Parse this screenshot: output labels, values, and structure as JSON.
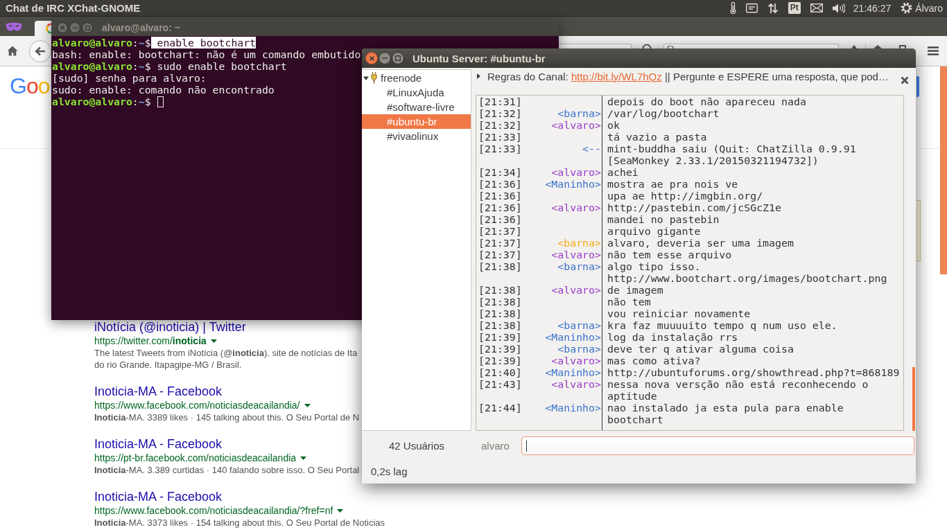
{
  "top_panel": {
    "app_title": "Chat de IRC XChat-GNOME",
    "keyboard": "Pt",
    "clock": "21:46:27",
    "user": "Álvaro"
  },
  "browser": {
    "logo": "Goo",
    "results": [
      {
        "title": "iNotícia (@inoticia) | Twitter",
        "url": "https://twitter.com/**inoticia**",
        "snippet": [
          "The latest Tweets from iNotícia (@**inoticia**). site de notícias de Ita",
          "do rio Grande. Itapagipe-MG / Brasil."
        ]
      },
      {
        "title": "Inoticia-MA - Facebook",
        "url": "https://www.facebook.com/noticiasdeacailandia/",
        "snippet": [
          "**Inoticia**-MA. 3389 likes · 145 talking about this. O Seu Portal de N"
        ]
      },
      {
        "title": "Inoticia-MA - Facebook",
        "url": "https://pt-br.facebook.com/noticiasdeacailandia",
        "snippet": [
          "**Inoticia**-MA. 3.389 curtidas · 140 falando sobre isso. O Seu Portal"
        ]
      },
      {
        "title": "Inoticia-MA - Facebook",
        "url": "https://www.facebook.com/noticiasdeacailandia/?fref=nf",
        "snippet": [
          "**Inoticia**-MA. 3373 likes · 154 talking about this. O Seu Portal de Noticias"
        ]
      }
    ]
  },
  "terminal": {
    "title": "alvaro@alvaro: ~",
    "cursor": true,
    "lines": [
      {
        "segments": [
          {
            "kind": "user",
            "text": "alvaro@alvaro"
          },
          {
            "kind": "plain",
            "text": ":"
          },
          {
            "kind": "path",
            "text": "~"
          },
          {
            "kind": "plain",
            "text": "$"
          },
          {
            "kind": "selection",
            "text": " enable bootchart"
          }
        ]
      },
      {
        "segments": [
          {
            "kind": "plain",
            "text": "bash: enable: bootchart: não é um comando embutido"
          }
        ]
      },
      {
        "segments": [
          {
            "kind": "user",
            "text": "alvaro@alvaro"
          },
          {
            "kind": "plain",
            "text": ":"
          },
          {
            "kind": "path",
            "text": "~"
          },
          {
            "kind": "plain",
            "text": "$ sudo enable bootchart"
          }
        ]
      },
      {
        "segments": [
          {
            "kind": "plain",
            "text": "[sudo] senha para alvaro:"
          }
        ]
      },
      {
        "segments": [
          {
            "kind": "plain",
            "text": "sudo: enable: comando não encontrado"
          }
        ]
      },
      {
        "segments": [
          {
            "kind": "user",
            "text": "alvaro@alvaro"
          },
          {
            "kind": "plain",
            "text": ":"
          },
          {
            "kind": "path",
            "text": "~"
          },
          {
            "kind": "plain",
            "text": "$"
          }
        ]
      }
    ]
  },
  "xchat": {
    "title": "Ubuntu Server: #ubuntu-br",
    "server": {
      "name": "freenode",
      "expanded": true,
      "channels": [
        {
          "name": "#LinuxAjuda",
          "selected": false
        },
        {
          "name": "#software-livre",
          "selected": false
        },
        {
          "name": "#ubuntu-br",
          "selected": true
        },
        {
          "name": "#vivaolinux",
          "selected": false
        }
      ]
    },
    "topic": {
      "before": "Regras do Canal: ",
      "link": "http://bit.ly/WL7hQz",
      "after": " || Pergunte e ESPERE uma resposta, que pod…"
    },
    "lines": [
      {
        "time": "[21:31]",
        "message": "depois do boot não apareceu nada"
      },
      {
        "time": "[21:32]",
        "nick": "<barna>",
        "color": "#3a72cc",
        "message": "/var/log/bootchart"
      },
      {
        "time": "[21:32]",
        "nick": "<alvaro>",
        "color": "#9a3acb",
        "message": "ok"
      },
      {
        "time": "[21:33]",
        "message": "tá vazio a pasta"
      },
      {
        "time": "[21:33]",
        "nick": "<--",
        "color": "#3a72cc",
        "message": "mint-buddha saiu (Quit: ChatZilla 0.9.91 [SeaMonkey 2.33.1/20150321194732])"
      },
      {
        "time": "[21:34]",
        "nick": "<alvaro>",
        "color": "#9a3acb",
        "message": "achei"
      },
      {
        "time": "[21:36]",
        "nick": "<Maninho>",
        "color": "#3a72cc",
        "message": "mostra ae pra nois ve"
      },
      {
        "time": "[21:36]",
        "message": "upa ae http://imgbin.org/"
      },
      {
        "time": "[21:36]",
        "nick": "<alvaro>",
        "color": "#9a3acb",
        "message": "http://pastebin.com/jcSGcZ1e"
      },
      {
        "time": "[21:36]",
        "message": "mandei no pastebin"
      },
      {
        "time": "[21:37]",
        "message": "arquivo gigante"
      },
      {
        "time": "[21:37]",
        "nick": "<barna>",
        "color": "#f6a81a",
        "message": "alvaro, deveria ser uma imagem"
      },
      {
        "time": "[21:37]",
        "nick": "<alvaro>",
        "color": "#9a3acb",
        "message": "não tem esse arquivo"
      },
      {
        "time": "[21:38]",
        "nick": "<barna>",
        "color": "#3a72cc",
        "message": "algo tipo isso. http://www.bootchart.org/images/bootchart.png"
      },
      {
        "time": "[21:38]",
        "nick": "<alvaro>",
        "color": "#9a3acb",
        "message": "de imagem"
      },
      {
        "time": "[21:38]",
        "message": "não tem"
      },
      {
        "time": "[21:38]",
        "message": "vou reiniciar novamente"
      },
      {
        "time": "[21:38]",
        "nick": "<barna>",
        "color": "#3a72cc",
        "message": "kra faz muuuuito tempo q num uso ele."
      },
      {
        "time": "[21:39]",
        "nick": "<Maninho>",
        "color": "#3a72cc",
        "message": "log da instalação rrs"
      },
      {
        "time": "[21:39]",
        "nick": "<barna>",
        "color": "#3a72cc",
        "message": "deve ter q ativar alguma coisa"
      },
      {
        "time": "[21:39]",
        "nick": "<alvaro>",
        "color": "#9a3acb",
        "message": "mas como ativa?"
      },
      {
        "time": "[21:40]",
        "nick": "<Maninho>",
        "color": "#3a72cc",
        "message": "http://ubuntuforums.org/showthread.php?t=868189"
      },
      {
        "time": "[21:43]",
        "nick": "<alvaro>",
        "color": "#9a3acb",
        "message": "nessa nova versção não está reconhecendo o aptitude"
      },
      {
        "time": "[21:44]",
        "nick": "<Maninho>",
        "color": "#3a72cc",
        "message": "nao instalado ja esta pula para enable bootchart"
      }
    ],
    "user_count": "42 Usuários",
    "nick": "alvaro",
    "input_focused": true,
    "lag": "0,2s lag"
  }
}
